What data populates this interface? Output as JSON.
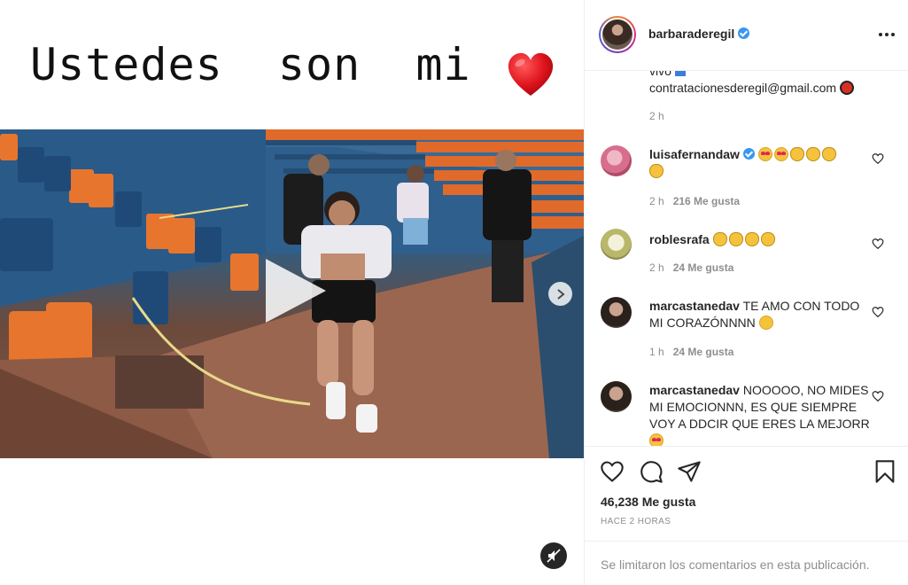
{
  "post": {
    "caption_text": "Ustedes  son  mi",
    "caption_emoji": "heart-emoji"
  },
  "header": {
    "username": "barbaraderegil",
    "verified": true
  },
  "description_tail": {
    "line1": "vivo",
    "line2": "contrataciones​deregil@gmail.com",
    "time": "2 h"
  },
  "comments": [
    {
      "user": "luisafernandaw",
      "verified": true,
      "text": "",
      "emojis": [
        "heart-eyes",
        "heart-eyes",
        "clap",
        "clap",
        "clap",
        "clap"
      ],
      "time": "2 h",
      "likes": "216 Me gusta"
    },
    {
      "user": "roblesrafa",
      "verified": false,
      "text": "",
      "emojis": [
        "clap",
        "clap",
        "clap",
        "clap"
      ],
      "time": "2 h",
      "likes": "24 Me gusta"
    },
    {
      "user": "marcastanedav",
      "verified": false,
      "text": "TE AMO CON TODO MI CORAZÓNNNN",
      "emojis": [
        "sad"
      ],
      "time": "1 h",
      "likes": "24 Me gusta"
    },
    {
      "user": "marcastanedav",
      "verified": false,
      "text": "NOOOOO, NO MIDES MI EMOCIONNN, ES QUE SIEMPRE VOY A DDCIR QUE ERES LA MEJORR",
      "emojis": [
        "heart-eyes"
      ],
      "time": "",
      "likes": ""
    }
  ],
  "actions": {
    "likes_count": "46,238 Me gusta",
    "time_ago": "HACE 2 HORAS",
    "comments_limited": "Se limitaron los comentarios en esta publicación."
  },
  "colors": {
    "accent_blue": "#3897f0",
    "text_primary": "#262626",
    "text_secondary": "#8e8e8e",
    "border": "#efefef"
  }
}
